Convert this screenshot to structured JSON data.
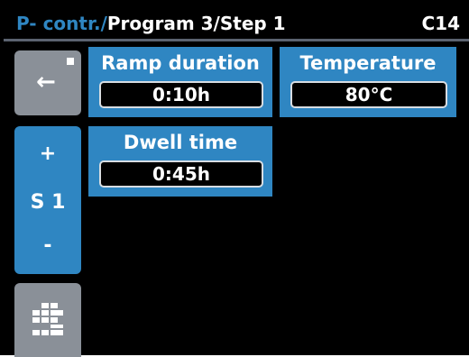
{
  "header": {
    "path_prefix": "P- contr./",
    "path_main": "Program 3/Step 1",
    "code": "C14"
  },
  "sidebar": {
    "back_symbol": "←",
    "plus_symbol": "+",
    "step_label": "S 1",
    "minus_symbol": "-"
  },
  "params": {
    "ramp": {
      "title": "Ramp duration",
      "value": "0:10h"
    },
    "temperature": {
      "title": "Temperature",
      "value": "80°C"
    },
    "dwell": {
      "title": "Dwell time",
      "value": "0:45h"
    }
  },
  "colors": {
    "accent": "#2f86c2",
    "button_gray": "#8a9098",
    "background": "#000000"
  },
  "icons": {
    "back": "arrow-left-icon",
    "menu": "grid-menu-icon"
  }
}
